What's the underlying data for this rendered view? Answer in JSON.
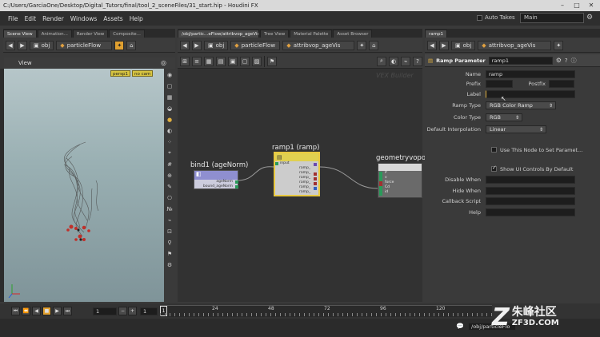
{
  "window": {
    "title": "C:/Users/GarciaOne/Desktop/Digital_Tutors/final/tool_2_sceneFiles/31_start.hip - Houdini FX"
  },
  "menu": [
    "File",
    "Edit",
    "Render",
    "Windows",
    "Assets",
    "Help"
  ],
  "top_right": {
    "auto_takes": "Auto Takes",
    "desktop": "Main"
  },
  "left_pane": {
    "tabs": [
      "Scene View",
      "Animation...",
      "Render View",
      "Composite..."
    ],
    "path_root": "obj",
    "path_node": "particleFlow",
    "viewer_title": "View",
    "camera": "persp1",
    "display": "no cam"
  },
  "network_pane": {
    "tabs": [
      "/obj/partic…eFlow/attribvop_ageVis",
      "Tree View",
      "Material Palette",
      "Asset Browser"
    ],
    "path_root": "obj",
    "path_node": "particleFlow",
    "path_vop": "attribvop_ageVis",
    "watermark": "VEX Builder",
    "nodes": {
      "bind": {
        "label": "bind1 (ageNorm)",
        "out1": "ageNorm",
        "out2": "bound_ageNorm"
      },
      "ramp": {
        "label": "ramp1 (ramp)",
        "inputs": [
          "input",
          "ramp_",
          "ramp_",
          "ramp_",
          "ramp_",
          "ramp_",
          "ramp_"
        ]
      },
      "geo": {
        "label": "geometryvopo",
        "inputs": [
          "P",
          "v",
          "force",
          "Cd",
          "id"
        ]
      }
    }
  },
  "param_pane": {
    "tab": "ramp1",
    "path_root": "obj",
    "path_vop": "attribvop_ageVis",
    "header_type": "Ramp Parameter",
    "header_name": "ramp1",
    "fields": {
      "name_label": "Name",
      "name_value": "ramp",
      "prefix_label": "Prefix",
      "postfix_label": "Postfix",
      "label_label": "Label",
      "ramp_type_label": "Ramp Type",
      "ramp_type_value": "RGB Color Ramp",
      "color_type_label": "Color Type",
      "color_type_value": "RGB",
      "interp_label": "Default Interpolation",
      "interp_value": "Linear",
      "use_node_label": "Use This Node to Set Paramet...",
      "show_ui_label": "Show UI Controls By Default",
      "disable_when_label": "Disable When",
      "hide_when_label": "Hide When",
      "callback_label": "Callback Script",
      "help_label": "Help"
    }
  },
  "timeline": {
    "frame": "1",
    "start": "1",
    "ticks": [
      "24",
      "48",
      "72",
      "96",
      "120"
    ]
  },
  "status": {
    "path": "/obj/particleFlo"
  },
  "watermark_logo": {
    "text": "朱峰社区",
    "sub": "ZF3D.COM"
  }
}
